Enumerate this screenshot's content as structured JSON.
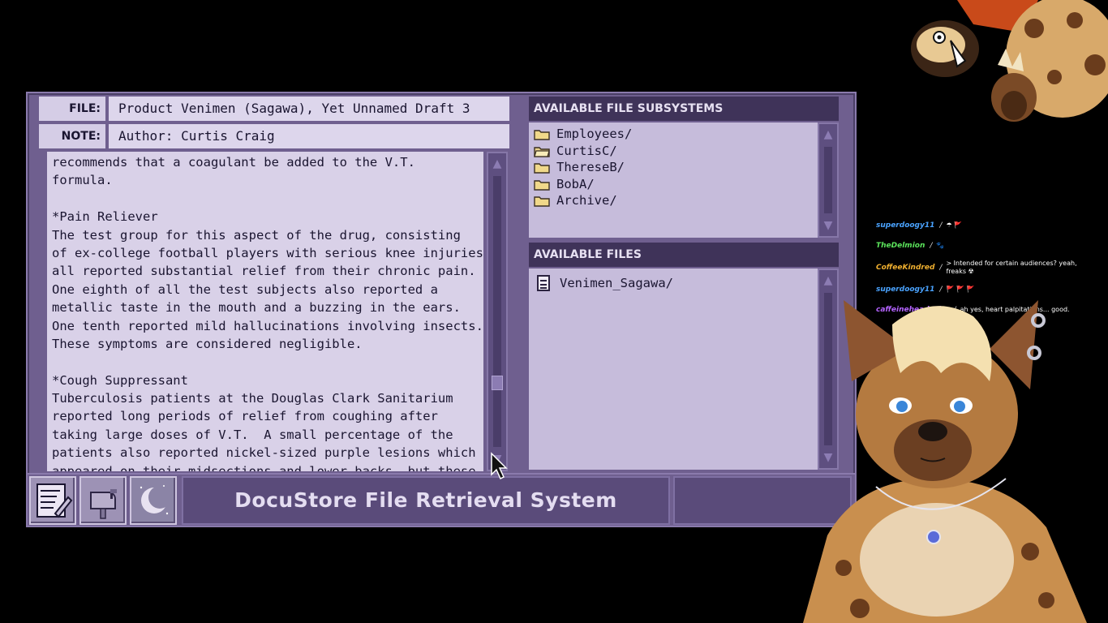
{
  "document": {
    "file_label": "FILE:",
    "file_value": "Product Venimen (Sagawa), Yet Unnamed Draft 3",
    "note_label": "NOTE:",
    "note_value": "Author: Curtis Craig",
    "lines": [
      "recommends that a coagulant be added to the V.T.",
      "formula.",
      "",
      "*Pain Reliever",
      "The test group for this aspect of the drug, consisting",
      "of ex-college football players with serious knee injuries,",
      "all reported substantial relief from their chronic pain.",
      "One eighth of all the test subjects also reported a",
      "metallic taste in the mouth and a buzzing in the ears.",
      "One tenth reported mild hallucinations involving insects.",
      "These symptoms are considered negligible.",
      "",
      "*Cough Suppressant",
      "Tuberculosis patients at the Douglas Clark Sanitarium",
      "reported long periods of relief from coughing after",
      "taking large doses of V.T.  A small percentage of the",
      "patients also reported nickel-sized purple lesions which",
      "appeared on their midsections and lower backs, but these"
    ],
    "scroll_position": 0.78
  },
  "subsystems": {
    "header": "AVAILABLE FILE SUBSYSTEMS",
    "items": [
      "Employees/",
      "CurtisC/",
      "ThereseB/",
      "BobA/",
      "Archive/"
    ],
    "open_index": 1
  },
  "files": {
    "header": "AVAILABLE FILES",
    "items": [
      "Venimen_Sagawa/"
    ]
  },
  "taskbar": {
    "title": "DocuStore File Retrieval System",
    "buttons": [
      "notepad-icon",
      "mailbox-icon",
      "moon-icon"
    ]
  },
  "chat": [
    {
      "user": "superdoogy11",
      "user_color": "#4aa3ff",
      "message": "☂ 🚩"
    },
    {
      "user": "TheDelmion",
      "user_color": "#5be35b",
      "message": "🐾"
    },
    {
      "user": "CoffeeKindred",
      "user_color": "#f0b030",
      "message": "> Intended for certain audiences? yeah, freaks ☢"
    },
    {
      "user": "superdoogy11",
      "user_color": "#4aa3ff",
      "message": "🚩 🚩 🚩"
    },
    {
      "user": "caffeineheadache",
      "user_color": "#b463ff",
      "message": "ah yes, heart palpitations... good."
    }
  ],
  "colors": {
    "window": "#6f5f8f",
    "document_bg": "#d9d1e8",
    "header_bg": "#3f3359",
    "text": "#1a1530"
  }
}
